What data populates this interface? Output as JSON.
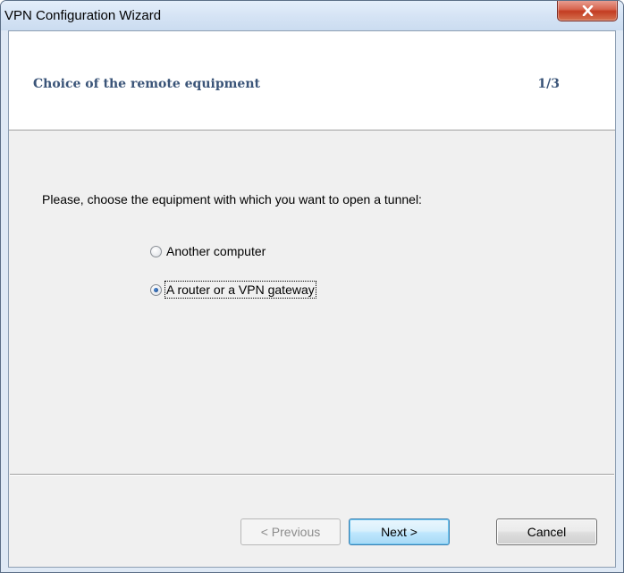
{
  "window": {
    "title": "VPN Configuration Wizard",
    "close_icon": "close-x-icon"
  },
  "header": {
    "title": "Choice of the remote equipment",
    "step": "1/3"
  },
  "body": {
    "instruction": "Please, choose the equipment with which you want to open a tunnel:",
    "options": [
      {
        "label": "Another computer",
        "selected": false
      },
      {
        "label": "A router or a VPN gateway",
        "selected": true
      }
    ]
  },
  "buttons": {
    "previous_label": "< Previous",
    "next_label": "Next >",
    "cancel_label": "Cancel"
  },
  "colors": {
    "header_text": "#3a5478",
    "close_button": "#c33d22",
    "default_button_border": "#3c7fb1"
  }
}
